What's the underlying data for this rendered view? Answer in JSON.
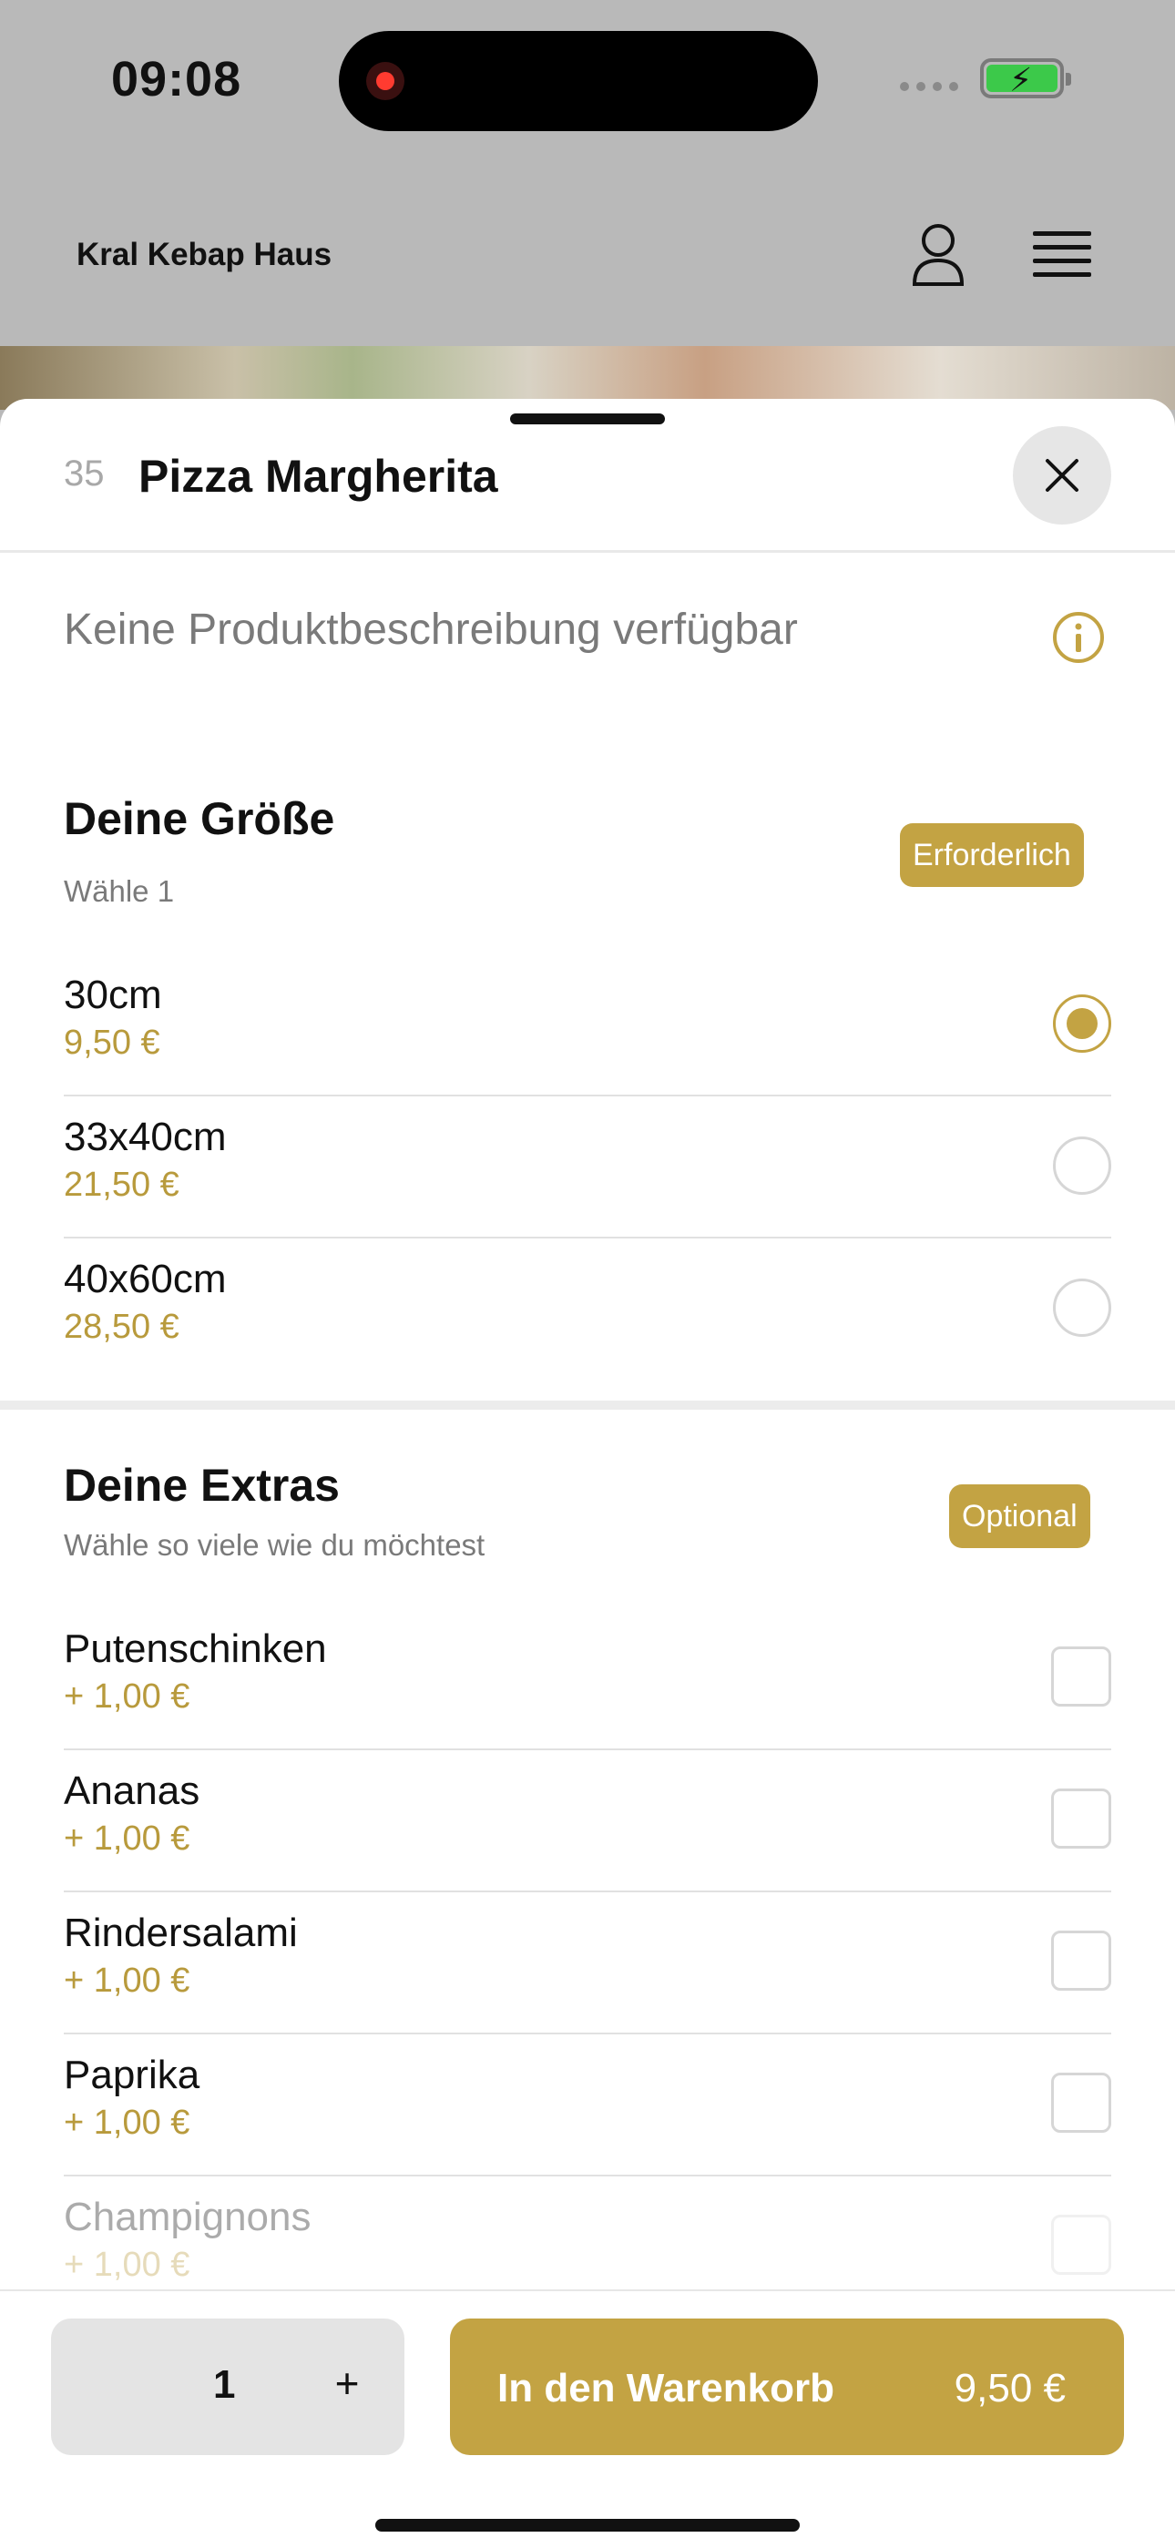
{
  "status_bar": {
    "time": "09:08"
  },
  "app": {
    "brand": "Kral Kebap Haus"
  },
  "product": {
    "number": "35",
    "title": "Pizza Margherita",
    "description": "Keine Produktbeschreibung verfügbar"
  },
  "size_section": {
    "title": "Deine Größe",
    "subtitle": "Wähle 1",
    "badge": "Erforderlich",
    "options": [
      {
        "label": "30cm",
        "price": "9,50 €",
        "selected": true
      },
      {
        "label": "33x40cm",
        "price": "21,50 €",
        "selected": false
      },
      {
        "label": "40x60cm",
        "price": "28,50 €",
        "selected": false
      }
    ]
  },
  "extras_section": {
    "title": "Deine Extras",
    "subtitle": "Wähle so viele wie du möchtest",
    "badge": "Optional",
    "options": [
      {
        "label": "Putenschinken",
        "price": "+ 1,00 €"
      },
      {
        "label": "Ananas",
        "price": "+ 1,00 €"
      },
      {
        "label": "Rindersalami",
        "price": "+ 1,00 €"
      },
      {
        "label": "Paprika",
        "price": "+ 1,00 €"
      },
      {
        "label": "Champignons",
        "price": "+ 1,00 €"
      }
    ]
  },
  "cart": {
    "quantity": "1",
    "plus": "+",
    "button_label": "In den Warenkorb",
    "total": "9,50 €"
  },
  "colors": {
    "accent": "#c3a343",
    "price_text": "#b89a3c",
    "backdrop": "#b9b9b9"
  }
}
